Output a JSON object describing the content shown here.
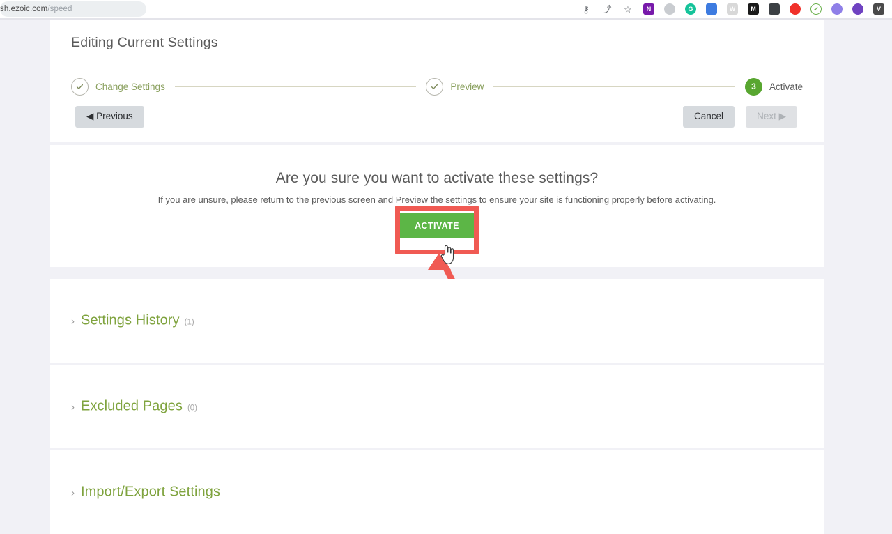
{
  "browser": {
    "url_prefix": "sh.ezoic.com",
    "url_path": "/speed",
    "toolbar_icons": [
      {
        "name": "password-key-icon",
        "glyph": "⚷",
        "type": "glyph"
      },
      {
        "name": "share-icon",
        "glyph": "⤴",
        "type": "glyph"
      },
      {
        "name": "bookmark-star-icon",
        "glyph": "☆",
        "type": "glyph"
      },
      {
        "name": "onenote-extension-icon",
        "label": "N",
        "color": "#7719aa",
        "shape": "square"
      },
      {
        "name": "grammarly-gray-extension-icon",
        "label": "",
        "color": "#c9ccd0",
        "shape": "round"
      },
      {
        "name": "grammarly-extension-icon",
        "label": "G",
        "color": "#15c39a",
        "shape": "round"
      },
      {
        "name": "blue-note-extension-icon",
        "label": "",
        "color": "#3d7be0",
        "shape": "square"
      },
      {
        "name": "wiki-extension-icon",
        "label": "W",
        "color": "#d8d8d8",
        "shape": "square"
      },
      {
        "name": "gmail-extension-icon",
        "label": "M",
        "color": "#1a1a1a",
        "shape": "square"
      },
      {
        "name": "toolbox-extension-icon",
        "label": "",
        "color": "#3c4044",
        "shape": "square"
      },
      {
        "name": "honey-extension-icon",
        "label": "",
        "color": "#f0312a",
        "shape": "round"
      },
      {
        "name": "check-circle-extension-icon",
        "label": "✓",
        "color": "#ffffff",
        "shape": "round"
      },
      {
        "name": "purple-camera-extension-icon",
        "label": "",
        "color": "#8f7fe8",
        "shape": "round"
      },
      {
        "name": "color-wheel-extension-icon",
        "label": "",
        "color": "#6f42c1",
        "shape": "round"
      },
      {
        "name": "vidiq-extension-icon",
        "label": "V",
        "color": "#4a4a4a",
        "shape": "square"
      }
    ]
  },
  "wizard": {
    "title": "Editing Current Settings",
    "steps": [
      {
        "number": "",
        "label": "Change Settings",
        "state": "done"
      },
      {
        "number": "",
        "label": "Preview",
        "state": "done"
      },
      {
        "number": "3",
        "label": "Activate",
        "state": "active"
      }
    ],
    "buttons": {
      "previous": "◀ Previous",
      "cancel": "Cancel",
      "next": "Next ▶"
    }
  },
  "confirm": {
    "question": "Are you sure you want to activate these settings?",
    "subtext": "If you are unsure, please return to the previous screen and Preview the settings to ensure your site is functioning properly before activating.",
    "activate_label": "ACTIVATE"
  },
  "accordions": [
    {
      "title": "Settings History",
      "count": "(1)",
      "chevron": "›"
    },
    {
      "title": "Excluded Pages",
      "count": "(0)",
      "chevron": "›"
    },
    {
      "title": "Import/Export Settings",
      "count": "",
      "chevron": "›"
    }
  ],
  "colors": {
    "accent_green": "#7fa33e",
    "activate_green": "#5cb646",
    "step_active_green": "#58a630",
    "annotation_red": "#f05a53",
    "page_background": "#f1f1f6"
  }
}
